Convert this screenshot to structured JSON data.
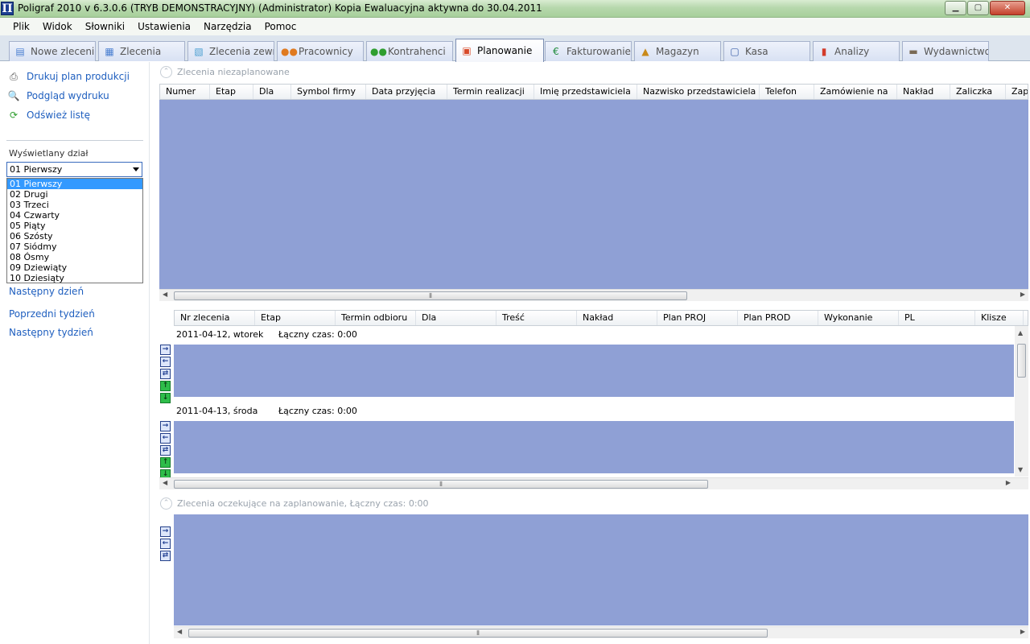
{
  "window": {
    "title": "Poligraf 2010 v 6.3.0.6 (TRYB DEMONSTRACYJNY) (Administrator) Kopia Ewaluacyjna aktywna do 30.04.2011",
    "icon_glyph": "Π"
  },
  "menu": [
    "Plik",
    "Widok",
    "Słowniki",
    "Ustawienia",
    "Narzędzia",
    "Pomoc"
  ],
  "tabs": [
    {
      "label": "Nowe zlecenie",
      "icon": "new-order-icon",
      "glyph": "▤",
      "color": "#4a7fd1"
    },
    {
      "label": "Zlecenia",
      "icon": "orders-icon",
      "glyph": "▦",
      "color": "#4a7fd1"
    },
    {
      "label": "Zlecenia zewn.",
      "icon": "external-orders-icon",
      "glyph": "▧",
      "color": "#4a9fd1"
    },
    {
      "label": "Pracownicy",
      "icon": "employees-icon",
      "glyph": "●●",
      "color": "#e07a1f"
    },
    {
      "label": "Kontrahenci",
      "icon": "contractors-icon",
      "glyph": "●●",
      "color": "#2f9e2f"
    },
    {
      "label": "Planowanie",
      "icon": "planning-icon",
      "glyph": "▣",
      "color": "#d84a2a"
    },
    {
      "label": "Fakturowanie",
      "icon": "invoicing-icon",
      "glyph": "€",
      "color": "#1e8a3a"
    },
    {
      "label": "Magazyn",
      "icon": "warehouse-icon",
      "glyph": "▲",
      "color": "#c98a1a"
    },
    {
      "label": "Kasa",
      "icon": "cash-register-icon",
      "glyph": "▢",
      "color": "#3b5fa8"
    },
    {
      "label": "Analizy",
      "icon": "analysis-chart-icon",
      "glyph": "▮",
      "color": "#d33b2a"
    },
    {
      "label": "Wydawnictwo",
      "icon": "publishing-icon",
      "glyph": "▬",
      "color": "#7a6a55"
    }
  ],
  "active_tab": "Planowanie",
  "sidebar": {
    "actions": [
      {
        "label": "Drukuj plan produkcji",
        "icon": "printer-icon",
        "glyph": "⎙"
      },
      {
        "label": "Podgląd wydruku",
        "icon": "print-preview-icon",
        "glyph": "🔍"
      },
      {
        "label": "Odśwież listę",
        "icon": "refresh-icon",
        "glyph": "⟳"
      }
    ],
    "department_label": "Wyświetlany dział",
    "department_selected": "01 Pierwszy",
    "department_options": [
      "01 Pierwszy",
      "02 Drugi",
      "03 Trzeci",
      "04 Czwarty",
      "05 Piąty",
      "06 Szósty",
      "07 Siódmy",
      "08 Ósmy",
      "09 Dziewiąty",
      "10 Dziesiąty"
    ],
    "nav": [
      "Następny dzień",
      "Poprzedni tydzień",
      "Następny tydzień"
    ]
  },
  "unplanned": {
    "title": "Zlecenia niezaplanowane",
    "columns": [
      "Numer",
      "Etap",
      "Dla",
      "Symbol firmy",
      "Data przyjęcia",
      "Termin realizacji",
      "Imię przedstawiciela",
      "Nazwisko przedstawiciela",
      "Telefon",
      "Zamówienie na",
      "Nakład",
      "Zaliczka",
      "Zap"
    ]
  },
  "planned": {
    "columns": [
      "Nr zlecenia",
      "Etap",
      "Termin odbioru",
      "Dla",
      "Treść",
      "Nakład",
      "Plan PROJ",
      "Plan PROD",
      "Wykonanie",
      "PL",
      "Klisze"
    ],
    "days": [
      {
        "date": "2011-04-12, wtorek",
        "total": "Łączny czas: 0:00"
      },
      {
        "date": "2011-04-13, środa",
        "total": "Łączny czas: 0:00"
      }
    ]
  },
  "waiting": {
    "title": "Zlecenia oczekujące na zaplanowanie, Łączny czas: 0:00"
  },
  "colors": {
    "grid_body": "#8fa0d5",
    "link": "#1f5fbf",
    "selection": "#3399ff"
  }
}
